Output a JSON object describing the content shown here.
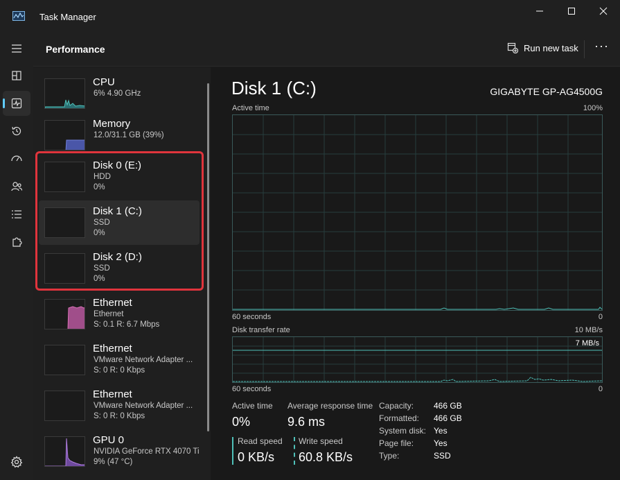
{
  "window": {
    "title": "Task Manager"
  },
  "header": {
    "title": "Performance",
    "run_new_task": "Run new task"
  },
  "nav": [
    "menu",
    "processes",
    "performance",
    "app-history",
    "startup-apps",
    "users",
    "details",
    "services",
    "settings"
  ],
  "devices": [
    {
      "name": "CPU",
      "sub1": "6% 4.90 GHz",
      "sub2": ""
    },
    {
      "name": "Memory",
      "sub1": "12.0/31.1 GB (39%)",
      "sub2": ""
    },
    {
      "name": "Disk 0 (E:)",
      "sub1": "HDD",
      "sub2": "0%"
    },
    {
      "name": "Disk 1 (C:)",
      "sub1": "SSD",
      "sub2": "0%"
    },
    {
      "name": "Disk 2 (D:)",
      "sub1": "SSD",
      "sub2": "0%"
    },
    {
      "name": "Ethernet",
      "sub1": "Ethernet",
      "sub2": "S: 0.1 R: 6.7 Mbps"
    },
    {
      "name": "Ethernet",
      "sub1": "VMware Network Adapter ...",
      "sub2": "S: 0 R: 0 Kbps"
    },
    {
      "name": "Ethernet",
      "sub1": "VMware Network Adapter ...",
      "sub2": "S: 0 R: 0 Kbps"
    },
    {
      "name": "GPU 0",
      "sub1": "NVIDIA GeForce RTX 4070 Ti",
      "sub2": "9% (47 °C)"
    }
  ],
  "detail": {
    "title": "Disk 1 (C:)",
    "model": "GIGABYTE GP-AG4500G",
    "active_graph": {
      "label": "Active time",
      "max": "100%",
      "time": "60 seconds",
      "min": "0"
    },
    "transfer_graph": {
      "label": "Disk transfer rate",
      "max": "10 MB/s",
      "line": "7 MB/s",
      "time": "60 seconds",
      "min": "0"
    },
    "stats": {
      "active_time_label": "Active time",
      "active_time": "0%",
      "avg_response_label": "Average response time",
      "avg_response": "9.6 ms",
      "read_label": "Read speed",
      "read": "0 KB/s",
      "write_label": "Write speed",
      "write": "60.8 KB/s"
    },
    "properties": [
      {
        "key": "Capacity:",
        "value": "466 GB"
      },
      {
        "key": "Formatted:",
        "value": "466 GB"
      },
      {
        "key": "System disk:",
        "value": "Yes"
      },
      {
        "key": "Page file:",
        "value": "Yes"
      },
      {
        "key": "Type:",
        "value": "SSD"
      }
    ]
  },
  "colors": {
    "accent": "#60cdff",
    "disk": "#4fc1b9",
    "memory": "#6f7fd8",
    "ethernet": "#d870b6",
    "gpu": "#b07ee0",
    "highlight": "#e0343c"
  }
}
